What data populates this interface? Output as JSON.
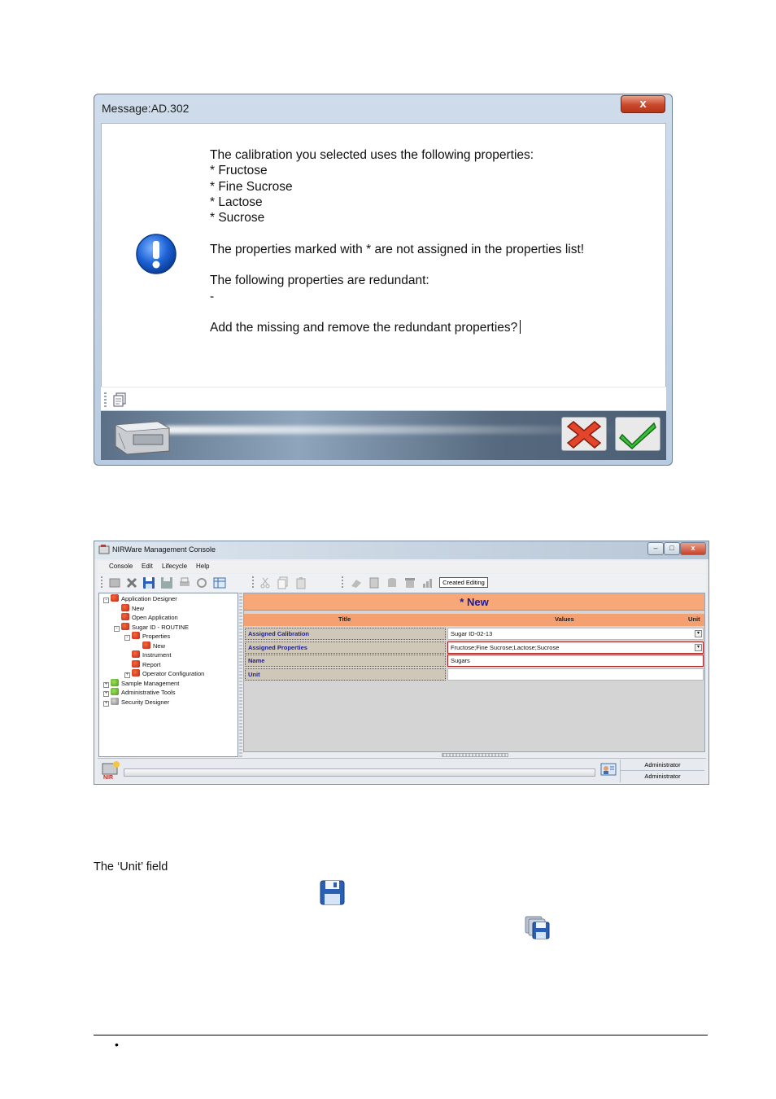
{
  "dialog": {
    "title": "Message:AD.302",
    "close_label": "x",
    "message_lines": [
      "The calibration you selected uses the following properties:",
      "* Fructose",
      "* Fine Sucrose",
      "* Lactose",
      "* Sucrose",
      "",
      "The properties marked with * are not assigned in the properties list!",
      "",
      "The following properties are redundant:",
      "-",
      "",
      "Add the missing and remove the redundant properties?"
    ]
  },
  "console": {
    "title": "NIRWare Management Console",
    "menu": [
      "Console",
      "Edit",
      "Lifecycle",
      "Help"
    ],
    "toolbar_status": "Created Editing",
    "tree": [
      {
        "label": "Application Designer",
        "level": 0,
        "icon": "red",
        "toggle": "-"
      },
      {
        "label": "New",
        "level": 1,
        "icon": "red",
        "toggle": ""
      },
      {
        "label": "Open Application",
        "level": 1,
        "icon": "red",
        "toggle": ""
      },
      {
        "label": "Sugar ID - ROUTINE",
        "level": 1,
        "icon": "red",
        "toggle": "-"
      },
      {
        "label": "Properties",
        "level": 2,
        "icon": "red",
        "toggle": "-"
      },
      {
        "label": "New",
        "level": 3,
        "icon": "red",
        "toggle": ""
      },
      {
        "label": "Instrument",
        "level": 2,
        "icon": "red",
        "toggle": ""
      },
      {
        "label": "Report",
        "level": 2,
        "icon": "red",
        "toggle": ""
      },
      {
        "label": "Operator Configuration",
        "level": 2,
        "icon": "red",
        "toggle": "+"
      },
      {
        "label": "Sample Management",
        "level": 0,
        "icon": "green",
        "toggle": "+"
      },
      {
        "label": "Administrative Tools",
        "level": 0,
        "icon": "green",
        "toggle": "+"
      },
      {
        "label": "Security Designer",
        "level": 0,
        "icon": "gray",
        "toggle": "+"
      }
    ],
    "panel_title": "* New",
    "grid_headers": {
      "title": "Title",
      "values": "Values",
      "unit": "Unit"
    },
    "grid_rows": [
      {
        "label": "Assigned Calibration",
        "value": "Sugar ID-02-13",
        "dropdown": true,
        "error": false
      },
      {
        "label": "Assigned Properties",
        "value": "Fructose;Fine Sucrose;Lactose;Sucrose",
        "dropdown": true,
        "error": true
      },
      {
        "label": "Name",
        "value": "Sugars",
        "dropdown": false,
        "error": true
      },
      {
        "label": "Unit",
        "value": "",
        "dropdown": false,
        "error": false
      }
    ],
    "status_users": [
      "Administrator",
      "Administrator"
    ]
  },
  "body": {
    "caption": "The ‘Unit’ field",
    "bullet": "•"
  }
}
